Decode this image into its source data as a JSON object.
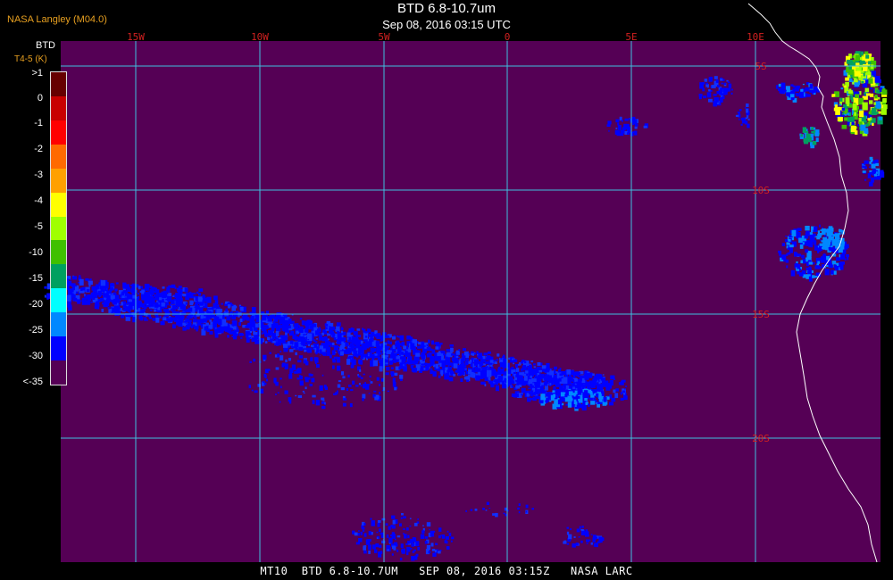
{
  "header": {
    "source": "NASA Langley (M04.0)",
    "title": "BTD 6.8-10.7um",
    "datetime": "Sep 08, 2016 03:15 UTC"
  },
  "legend": {
    "title": "BTD",
    "subtitle": "T4-5 (K)",
    "labels": [
      ">1",
      "0",
      "-1",
      "-2",
      "-3",
      "-4",
      "-5",
      "-10",
      "-15",
      "-20",
      "-25",
      "-30",
      "<-35"
    ],
    "colors": [
      "#660000",
      "#c80000",
      "#ff0000",
      "#ff6a00",
      "#ffa000",
      "#ffff00",
      "#a0ff00",
      "#40c000",
      "#00a060",
      "#00ffff",
      "#0088ff",
      "#0000ff",
      "#550055"
    ]
  },
  "map": {
    "background_color": "#550055",
    "grid_color": "#40c0e0",
    "lon_labels": [
      "15W",
      "10W",
      "5W",
      "0",
      "5E",
      "10E"
    ],
    "lat_labels": [
      "5S",
      "10S",
      "15S",
      "20S"
    ],
    "label_color": "#d02020",
    "coast_color": "#ffffff"
  },
  "footer": {
    "text": "MT10  BTD 6.8-10.7UM   SEP 08, 2016 03:15Z   NASA LARC"
  }
}
